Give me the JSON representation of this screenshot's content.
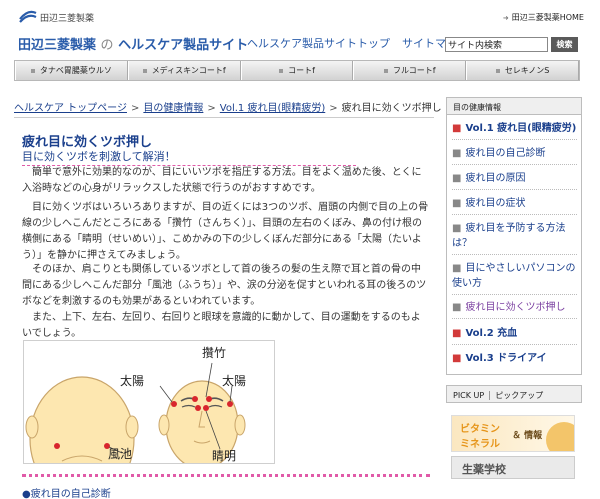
{
  "header": {
    "logo_text": "田辺三菱製薬",
    "home_link": "田辺三菱製薬HOME",
    "site_title_company": "田辺三菱製薬",
    "site_title_no": "の",
    "site_title_rest": "ヘルスケア製品サイト",
    "nav": [
      "ヘルスケア製品サイトトップ",
      "サイトマップ"
    ],
    "search_value": "サイト内検索",
    "search_button": "検索"
  },
  "tabs": [
    "タナベ胃腸薬ウルソ",
    "メディスキンコートf",
    "コートf",
    "フルコートf",
    "セレキノンS"
  ],
  "breadcrumb": {
    "items": [
      "ヘルスケア トップページ",
      "目の健康情報",
      "Vol.1 疲れ目(眼精疲労)"
    ],
    "current": "疲れ目に効くツボ押し"
  },
  "article": {
    "title": "疲れ目に効くツボ押し",
    "subtitle": "目に効くツボを刺激して解消！",
    "paragraphs": [
      "簡単で意外に効果的なのが、目にいいツボを指圧する方法。目をよく温めた後、とくに入浴時などの心身がリラックスした状態で行うのがおすすめです。",
      "目に効くツボはいろいろありますが、目の近くには3つのツボ、眉頭の内側で目の上の骨線の少しへこんだところにある「攢竹（さんちく）」、目頭の左右のくぼみ、鼻の付け根の横側にある「睛明（せいめい）」、こめかみの下の少しくぼんだ部分にある「太陽（たいよう）」を静かに押さえてみましょう。",
      "そのほか、肩こりとも関係しているツボとして首の後ろの髪の生え際で耳と首の骨の中間にある少しへこんだ部分「風池（ふうち）」や、涙の分泌を促すといわれる耳の後ろのツボなどを刺激するのも効果があるといわれています。",
      "また、上下、左右、左回り、右回りと眼球を意識的に動かして、目の運動をするのもよいでしょう。"
    ],
    "figure_labels": {
      "taiyo_left": "太陽",
      "fuchi": "風池",
      "sanchiku": "攢竹",
      "taiyo_right": "太陽",
      "seimei": "睛明"
    },
    "bottom_link": "●疲れ目の自己診断"
  },
  "sidebar": {
    "heading": "目の健康情報",
    "items": [
      {
        "label": "Vol.1 疲れ目(眼精疲労)",
        "level": "vol"
      },
      {
        "label": "疲れ目の自己診断",
        "level": "sub"
      },
      {
        "label": "疲れ目の原因",
        "level": "sub"
      },
      {
        "label": "疲れ目の症状",
        "level": "sub"
      },
      {
        "label": "疲れ目を予防する方法は？",
        "level": "sub"
      },
      {
        "label": "目にやさしいパソコンの使い方",
        "level": "sub"
      },
      {
        "label": "疲れ目に効くツボ押し",
        "level": "sub-current"
      },
      {
        "label": "Vol.2 充血",
        "level": "vol"
      },
      {
        "label": "Vol.3 ドライアイ",
        "level": "vol"
      }
    ]
  },
  "pickup": {
    "en": "PICK UP",
    "ja": "ピックアップ",
    "banner1_line1": "ビタミン",
    "banner1_line2": "ミネラル",
    "banner1_line3": "＆ 情報",
    "banner2": "生薬学校"
  },
  "colors": {
    "brand_blue": "#2a5caa",
    "link_blue": "#1a3f8c",
    "accent_pink": "#e05aa8",
    "acupoint_red": "#d8262d"
  }
}
